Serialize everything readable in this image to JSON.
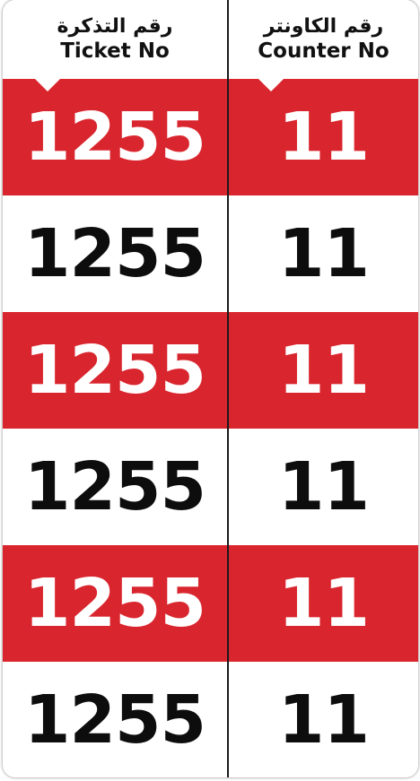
{
  "header": {
    "ticket_label_ar": "رقم التذكرة",
    "ticket_label_en": "Ticket No",
    "counter_label_ar": "رقم الكاونتر",
    "counter_label_en": "Counter No"
  },
  "rows": [
    {
      "ticket": "1255",
      "counter": "11",
      "style": "red"
    },
    {
      "ticket": "1255",
      "counter": "11",
      "style": "white"
    },
    {
      "ticket": "1255",
      "counter": "11",
      "style": "red"
    },
    {
      "ticket": "1255",
      "counter": "11",
      "style": "white"
    },
    {
      "ticket": "1255",
      "counter": "11",
      "style": "red"
    },
    {
      "ticket": "1255",
      "counter": "11",
      "style": "white"
    }
  ],
  "colors": {
    "accent_red": "#d9262e",
    "text_dark": "#0d0d0d",
    "background": "#ffffff"
  }
}
